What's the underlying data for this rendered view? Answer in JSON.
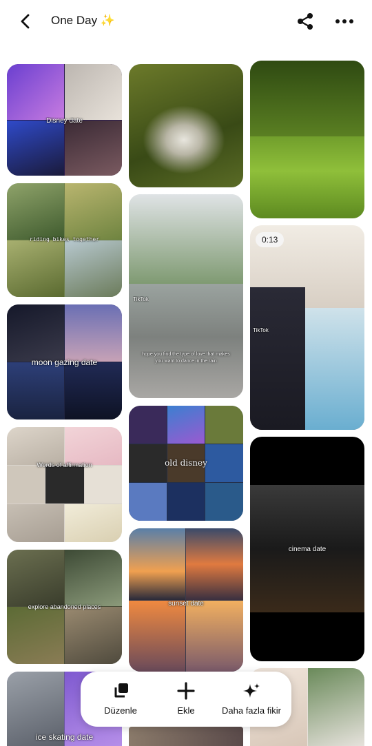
{
  "header": {
    "title": "One Day ✨"
  },
  "pins": [
    {
      "id": "disney-date",
      "caption": "Disney date"
    },
    {
      "id": "picnic"
    },
    {
      "id": "lawn"
    },
    {
      "id": "riding-bikes",
      "caption": "riding bikes together"
    },
    {
      "id": "rain-dance",
      "caption": "hope you find the type of love that makes you want to dance in the rain",
      "watermark": "TikTok"
    },
    {
      "id": "onesies",
      "badge": "0:13",
      "watermark": "TikTok"
    },
    {
      "id": "moon-gazing",
      "caption": "moon gazing date"
    },
    {
      "id": "old-disney",
      "caption": "old disney"
    },
    {
      "id": "affirmation",
      "caption": "Words of affirmation"
    },
    {
      "id": "cinema",
      "caption": "cinema date"
    },
    {
      "id": "sunset",
      "caption": "sunset date"
    },
    {
      "id": "abandoned",
      "caption": "explore abandoned places"
    },
    {
      "id": "ice-skating",
      "caption": "ice skating date"
    },
    {
      "id": "bottom-right"
    },
    {
      "id": "bottom-center"
    }
  ],
  "actions": [
    {
      "label": "Düzenle",
      "icon": "organize-icon"
    },
    {
      "label": "Ekle",
      "icon": "plus-icon"
    },
    {
      "label": "Daha fazla fikir",
      "icon": "sparkle-icon"
    }
  ]
}
